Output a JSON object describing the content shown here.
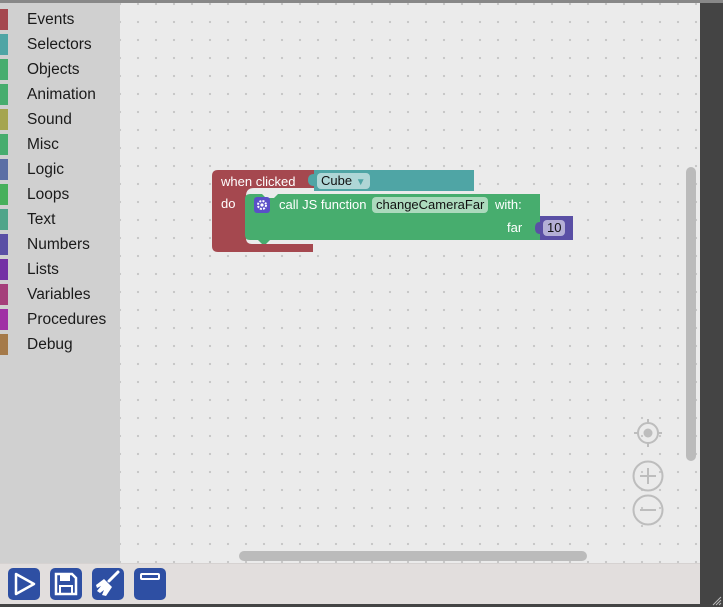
{
  "toolbox": {
    "categories": [
      {
        "label": "Events",
        "color": "#a5484f"
      },
      {
        "label": "Selectors",
        "color": "#4fa5a5"
      },
      {
        "label": "Objects",
        "color": "#47ad6e"
      },
      {
        "label": "Animation",
        "color": "#47ad6e"
      },
      {
        "label": "Sound",
        "color": "#a5a54f"
      },
      {
        "label": "Misc",
        "color": "#47ad6e"
      },
      {
        "label": "Logic",
        "color": "#5b6fa5"
      },
      {
        "label": "Loops",
        "color": "#47b05b"
      },
      {
        "label": "Text",
        "color": "#4fa58a"
      },
      {
        "label": "Numbers",
        "color": "#5a4fa5"
      },
      {
        "label": "Lists",
        "color": "#7430a5"
      },
      {
        "label": "Variables",
        "color": "#a53f7a"
      },
      {
        "label": "Procedures",
        "color": "#a030a5"
      },
      {
        "label": "Debug",
        "color": "#a57a4a"
      }
    ]
  },
  "blocks": {
    "event": {
      "label": "when clicked",
      "do_label": "do",
      "color": "#a5484f"
    },
    "selector": {
      "value": "Cube",
      "color": "#4fa5a5"
    },
    "call": {
      "label": "call JS function",
      "function_name": "changeCameraFar",
      "with_label": "with:",
      "param_label": "far",
      "color": "#47ad6e",
      "icon": "gear-icon"
    },
    "number": {
      "value": "10",
      "color": "#5a4fa5"
    }
  },
  "controls": {
    "recenter": "target-icon",
    "zoom_in": "plus-icon",
    "zoom_out": "minus-icon"
  },
  "toolbar": {
    "buttons": [
      {
        "name": "run",
        "icon": "play-icon"
      },
      {
        "name": "save",
        "icon": "floppy-disk-icon"
      },
      {
        "name": "clean",
        "icon": "broom-icon"
      },
      {
        "name": "window",
        "icon": "window-icon"
      }
    ],
    "color": "#2e4fa3"
  }
}
